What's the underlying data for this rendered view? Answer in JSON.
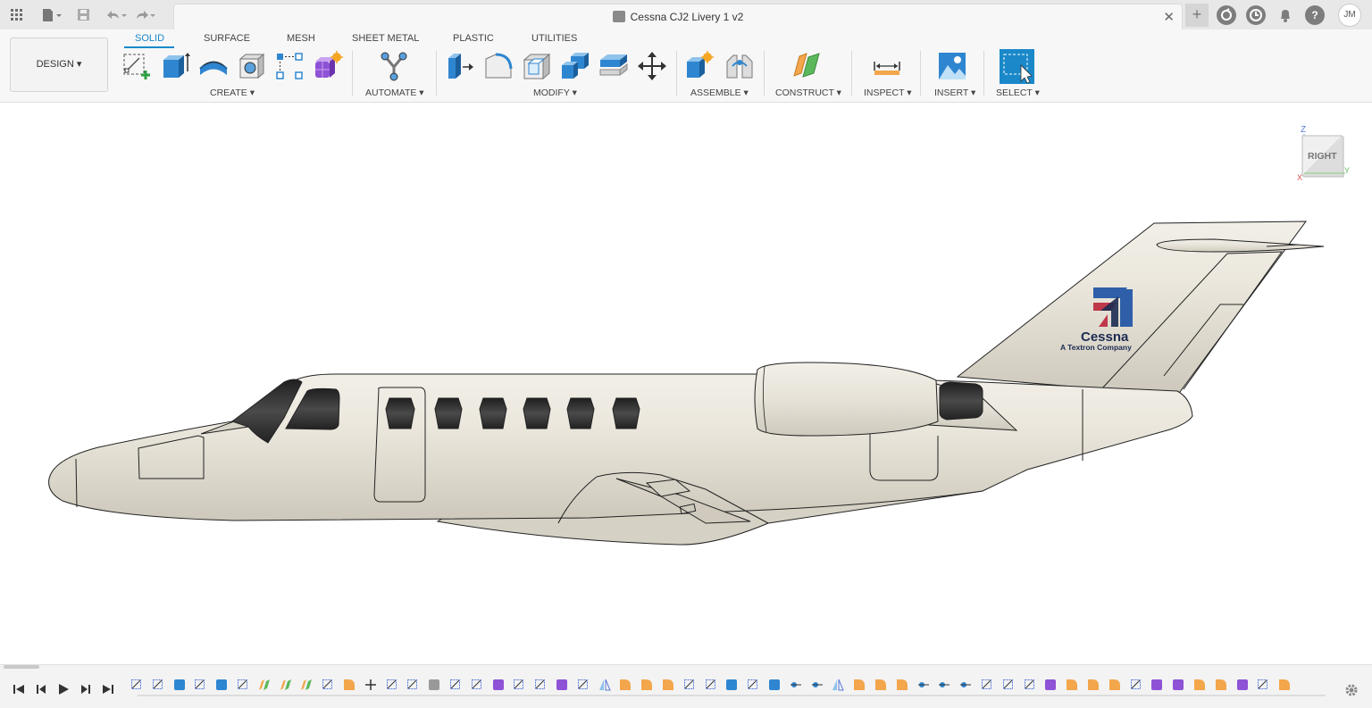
{
  "titlebar": {
    "document_title": "Cessna CJ2 Livery 1 v2",
    "close_glyph": "✕",
    "new_tab_glyph": "+",
    "user_initials": "JM",
    "left_icons": [
      "app-grid-icon",
      "file-icon",
      "save-icon",
      "undo-icon",
      "redo-icon"
    ],
    "right_icons": [
      "extensions-icon",
      "job-status-icon",
      "notifications-icon",
      "help-icon"
    ]
  },
  "workspace": {
    "label": "DESIGN"
  },
  "tabs": [
    {
      "label": "SOLID",
      "active": true
    },
    {
      "label": "SURFACE",
      "active": false
    },
    {
      "label": "MESH",
      "active": false
    },
    {
      "label": "SHEET METAL",
      "active": false
    },
    {
      "label": "PLASTIC",
      "active": false
    },
    {
      "label": "UTILITIES",
      "active": false
    }
  ],
  "groups": {
    "create": "CREATE",
    "automate": "AUTOMATE",
    "modify": "MODIFY",
    "assemble": "ASSEMBLE",
    "construct": "CONSTRUCT",
    "inspect": "INSPECT",
    "insert": "INSERT",
    "select": "SELECT"
  },
  "tools": {
    "create": [
      "create-sketch-icon",
      "extrude-icon",
      "revolve-icon",
      "hole-icon",
      "rectangular-pattern-icon",
      "create-form-icon"
    ],
    "automate": [
      "automate-icon"
    ],
    "modify": [
      "press-pull-icon",
      "fillet-icon",
      "shell-icon",
      "combine-icon",
      "offset-face-icon",
      "move-icon"
    ],
    "assemble": [
      "new-component-icon",
      "joint-icon"
    ],
    "construct": [
      "offset-plane-icon"
    ],
    "inspect": [
      "measure-icon"
    ],
    "insert": [
      "insert-image-icon"
    ],
    "select": [
      "select-icon"
    ]
  },
  "viewcube": {
    "face": "RIGHT",
    "axis_z": "Z",
    "axis_y": "Y",
    "axis_x": "X"
  },
  "model": {
    "logo_brand": "Cessna",
    "logo_tagline": "A Textron Company"
  },
  "colors": {
    "accent": "#1a88c9",
    "fuselage": "#ece8df",
    "window": "#2e2e2e",
    "logo_red": "#c0394b",
    "logo_blue": "#2f5fa8",
    "logo_navy": "#1c2b52"
  },
  "timeline": {
    "controls": [
      "first-icon",
      "previous-icon",
      "play-icon",
      "next-icon",
      "last-icon"
    ],
    "feature_count": 55
  }
}
